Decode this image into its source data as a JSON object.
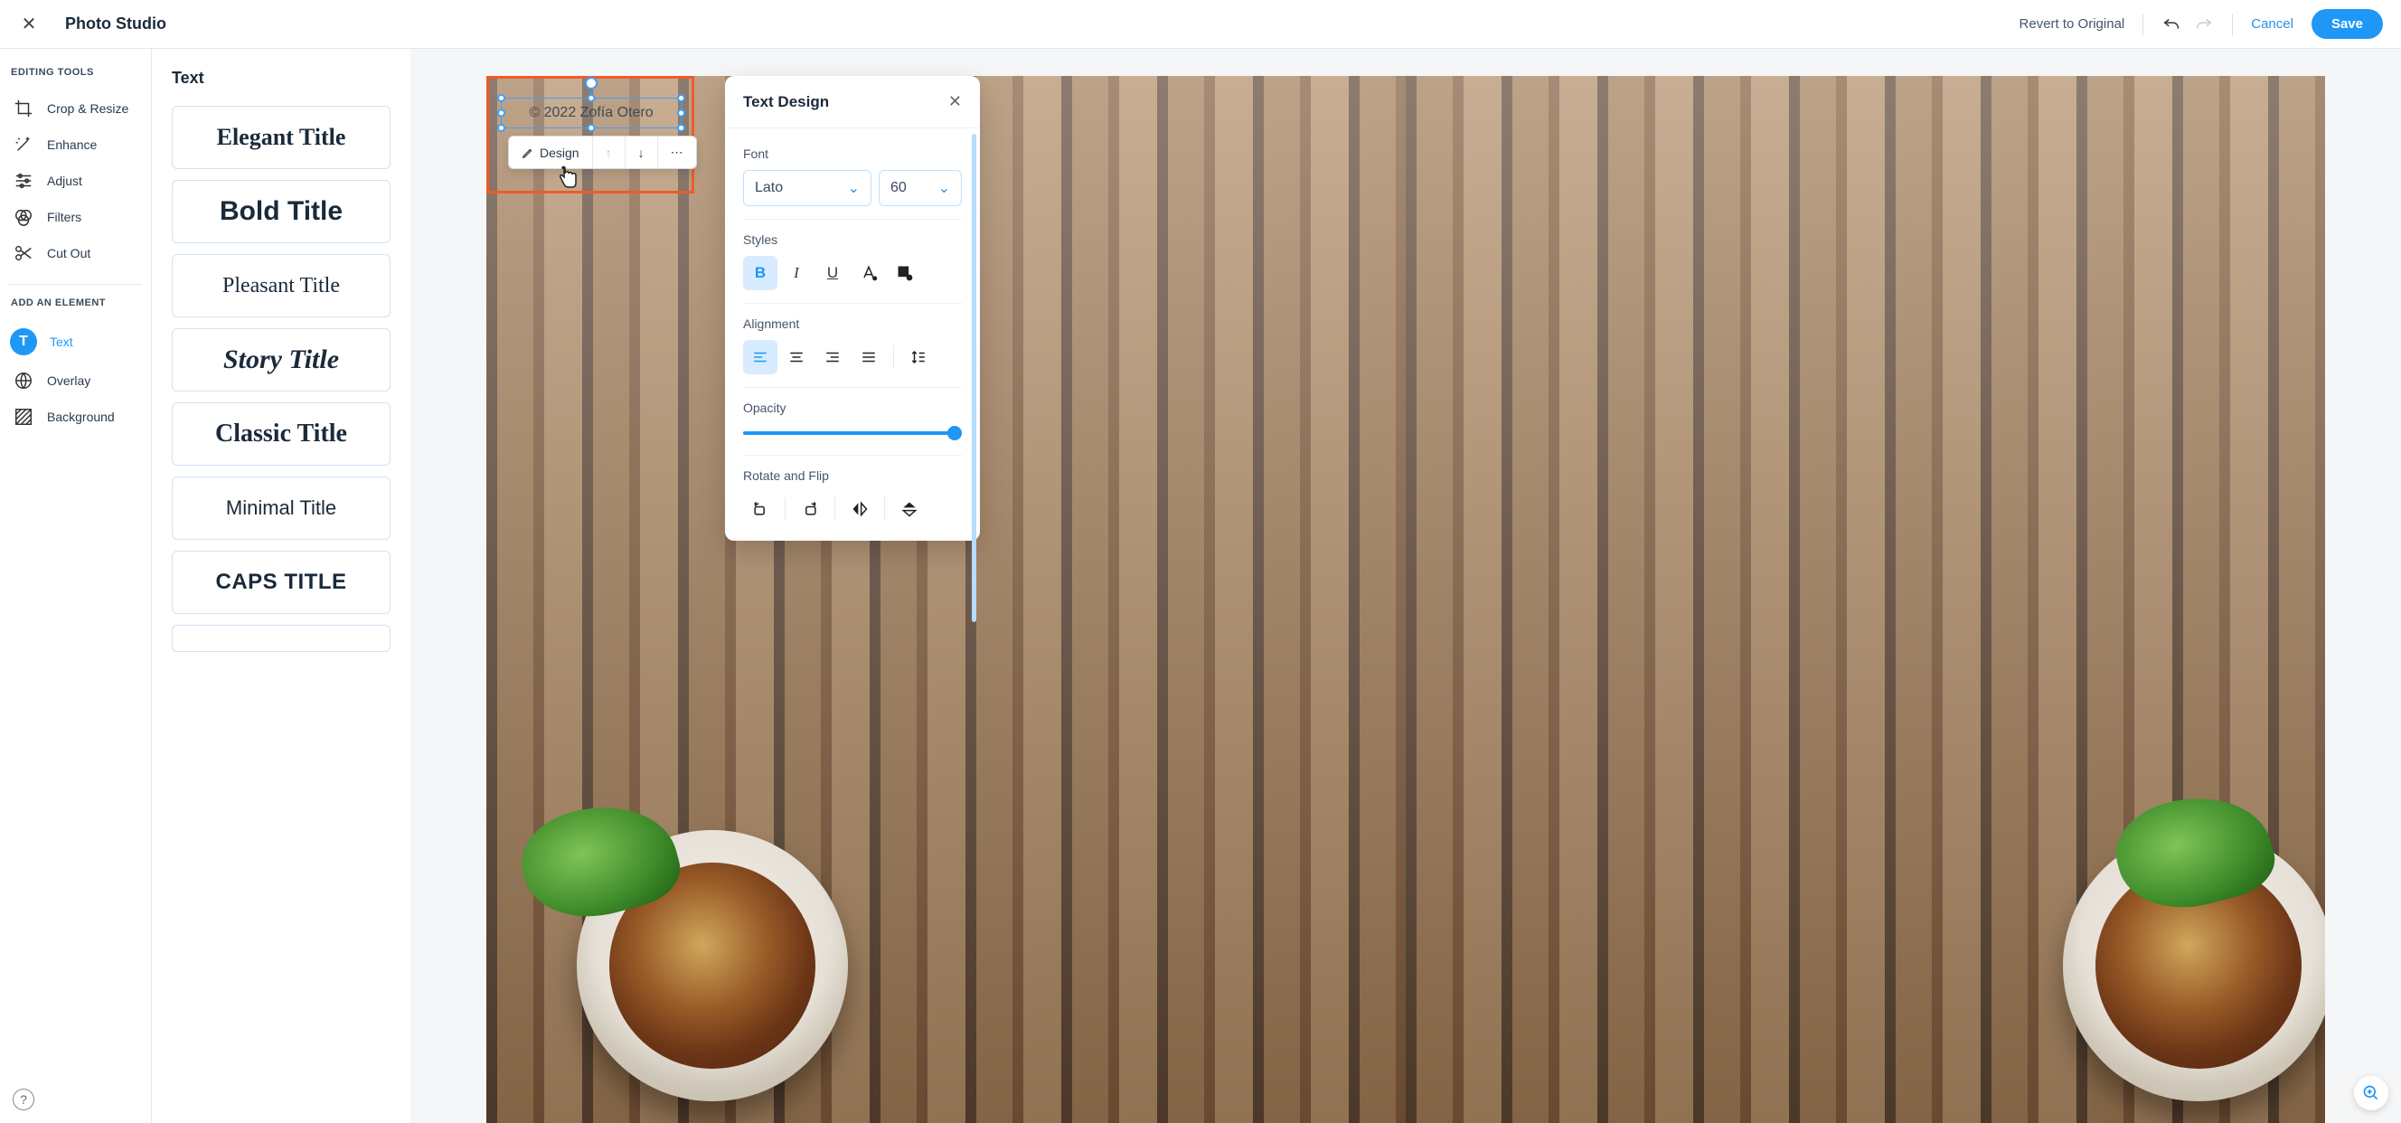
{
  "header": {
    "app_title": "Photo Studio",
    "revert": "Revert to Original",
    "cancel": "Cancel",
    "save": "Save"
  },
  "sidebar": {
    "section_editing": "EDITING TOOLS",
    "section_add": "ADD AN ELEMENT",
    "items_editing": [
      "Crop & Resize",
      "Enhance",
      "Adjust",
      "Filters",
      "Cut Out"
    ],
    "items_add": [
      "Text",
      "Overlay",
      "Background"
    ],
    "active_index": 0,
    "help_glyph": "?"
  },
  "textcol": {
    "heading": "Text",
    "presets": [
      "Elegant Title",
      "Bold Title",
      "Pleasant Title",
      "Story Title",
      "Classic Title",
      "Minimal Title",
      "CAPS TITLE"
    ]
  },
  "canvas": {
    "text_content": "© 2022 Zofía Otero",
    "ctx_design": "Design",
    "ctx_arrow_up": "↑",
    "ctx_arrow_down": "↓",
    "ctx_more": "⋯"
  },
  "panel": {
    "title": "Text Design",
    "font_label": "Font",
    "font_family": "Lato",
    "font_size": "60",
    "styles_label": "Styles",
    "bold": "B",
    "italic": "I",
    "underline": "U",
    "alignment_label": "Alignment",
    "opacity_label": "Opacity",
    "opacity_value": 100,
    "rotate_label": "Rotate and Flip"
  },
  "glyphs": {
    "close": "✕",
    "chev": "⌄"
  }
}
